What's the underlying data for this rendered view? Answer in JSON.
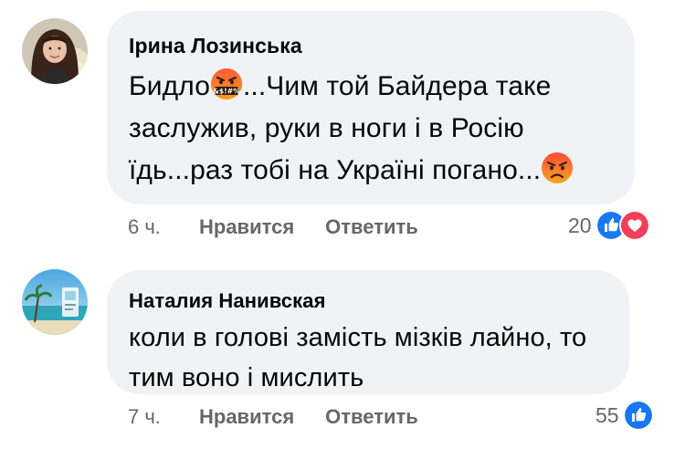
{
  "comments": [
    {
      "author": "Ірина Лозинська",
      "text_parts": {
        "before_emoji": "Бидло",
        "after_emoji": "...Чим той Байдера таке заслужив, руки в ноги і в Росію їдь...раз тобі на Україні погано...",
        "emoji_cursing_glyph": "&$!#%"
      },
      "time": "6 ч.",
      "like_label": "Нравится",
      "reply_label": "Ответить",
      "reaction_count": "20",
      "reactions": [
        "like-icon",
        "love-icon"
      ]
    },
    {
      "author": "Наталия Нанивская",
      "text": "коли в голові замість мізків лайно, то тим воно і мислить",
      "time": "7 ч.",
      "like_label": "Нравится",
      "reply_label": "Ответить",
      "reaction_count": "55",
      "reactions": [
        "like-icon"
      ]
    }
  ],
  "colors": {
    "bubble": "#f0f2f5",
    "meta": "#65676b",
    "like": "#1877f2",
    "love": "#f33e58",
    "angry": "#e9710f"
  }
}
